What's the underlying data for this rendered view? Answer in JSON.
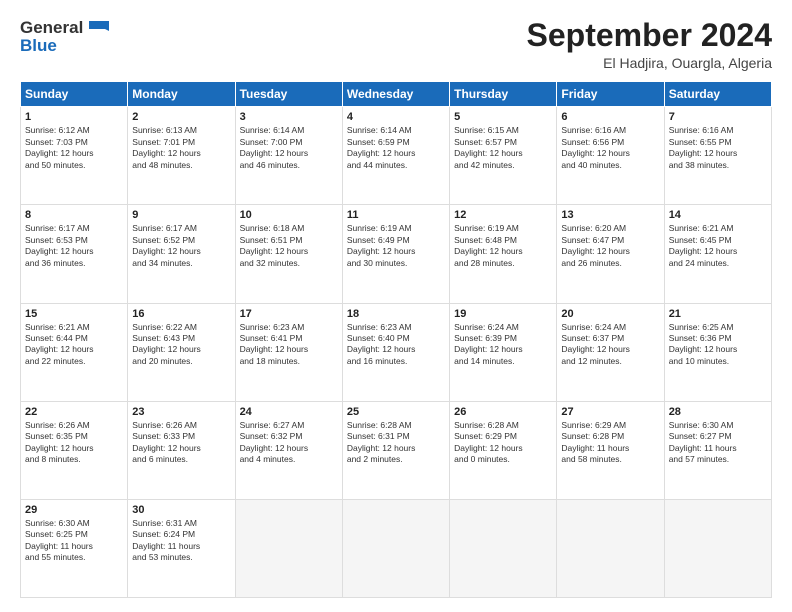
{
  "header": {
    "logo_general": "General",
    "logo_blue": "Blue",
    "month": "September 2024",
    "location": "El Hadjira, Ouargla, Algeria"
  },
  "days_of_week": [
    "Sunday",
    "Monday",
    "Tuesday",
    "Wednesday",
    "Thursday",
    "Friday",
    "Saturday"
  ],
  "weeks": [
    [
      {
        "day": "1",
        "lines": [
          "Sunrise: 6:12 AM",
          "Sunset: 7:03 PM",
          "Daylight: 12 hours",
          "and 50 minutes."
        ]
      },
      {
        "day": "2",
        "lines": [
          "Sunrise: 6:13 AM",
          "Sunset: 7:01 PM",
          "Daylight: 12 hours",
          "and 48 minutes."
        ]
      },
      {
        "day": "3",
        "lines": [
          "Sunrise: 6:14 AM",
          "Sunset: 7:00 PM",
          "Daylight: 12 hours",
          "and 46 minutes."
        ]
      },
      {
        "day": "4",
        "lines": [
          "Sunrise: 6:14 AM",
          "Sunset: 6:59 PM",
          "Daylight: 12 hours",
          "and 44 minutes."
        ]
      },
      {
        "day": "5",
        "lines": [
          "Sunrise: 6:15 AM",
          "Sunset: 6:57 PM",
          "Daylight: 12 hours",
          "and 42 minutes."
        ]
      },
      {
        "day": "6",
        "lines": [
          "Sunrise: 6:16 AM",
          "Sunset: 6:56 PM",
          "Daylight: 12 hours",
          "and 40 minutes."
        ]
      },
      {
        "day": "7",
        "lines": [
          "Sunrise: 6:16 AM",
          "Sunset: 6:55 PM",
          "Daylight: 12 hours",
          "and 38 minutes."
        ]
      }
    ],
    [
      {
        "day": "8",
        "lines": [
          "Sunrise: 6:17 AM",
          "Sunset: 6:53 PM",
          "Daylight: 12 hours",
          "and 36 minutes."
        ]
      },
      {
        "day": "9",
        "lines": [
          "Sunrise: 6:17 AM",
          "Sunset: 6:52 PM",
          "Daylight: 12 hours",
          "and 34 minutes."
        ]
      },
      {
        "day": "10",
        "lines": [
          "Sunrise: 6:18 AM",
          "Sunset: 6:51 PM",
          "Daylight: 12 hours",
          "and 32 minutes."
        ]
      },
      {
        "day": "11",
        "lines": [
          "Sunrise: 6:19 AM",
          "Sunset: 6:49 PM",
          "Daylight: 12 hours",
          "and 30 minutes."
        ]
      },
      {
        "day": "12",
        "lines": [
          "Sunrise: 6:19 AM",
          "Sunset: 6:48 PM",
          "Daylight: 12 hours",
          "and 28 minutes."
        ]
      },
      {
        "day": "13",
        "lines": [
          "Sunrise: 6:20 AM",
          "Sunset: 6:47 PM",
          "Daylight: 12 hours",
          "and 26 minutes."
        ]
      },
      {
        "day": "14",
        "lines": [
          "Sunrise: 6:21 AM",
          "Sunset: 6:45 PM",
          "Daylight: 12 hours",
          "and 24 minutes."
        ]
      }
    ],
    [
      {
        "day": "15",
        "lines": [
          "Sunrise: 6:21 AM",
          "Sunset: 6:44 PM",
          "Daylight: 12 hours",
          "and 22 minutes."
        ]
      },
      {
        "day": "16",
        "lines": [
          "Sunrise: 6:22 AM",
          "Sunset: 6:43 PM",
          "Daylight: 12 hours",
          "and 20 minutes."
        ]
      },
      {
        "day": "17",
        "lines": [
          "Sunrise: 6:23 AM",
          "Sunset: 6:41 PM",
          "Daylight: 12 hours",
          "and 18 minutes."
        ]
      },
      {
        "day": "18",
        "lines": [
          "Sunrise: 6:23 AM",
          "Sunset: 6:40 PM",
          "Daylight: 12 hours",
          "and 16 minutes."
        ]
      },
      {
        "day": "19",
        "lines": [
          "Sunrise: 6:24 AM",
          "Sunset: 6:39 PM",
          "Daylight: 12 hours",
          "and 14 minutes."
        ]
      },
      {
        "day": "20",
        "lines": [
          "Sunrise: 6:24 AM",
          "Sunset: 6:37 PM",
          "Daylight: 12 hours",
          "and 12 minutes."
        ]
      },
      {
        "day": "21",
        "lines": [
          "Sunrise: 6:25 AM",
          "Sunset: 6:36 PM",
          "Daylight: 12 hours",
          "and 10 minutes."
        ]
      }
    ],
    [
      {
        "day": "22",
        "lines": [
          "Sunrise: 6:26 AM",
          "Sunset: 6:35 PM",
          "Daylight: 12 hours",
          "and 8 minutes."
        ]
      },
      {
        "day": "23",
        "lines": [
          "Sunrise: 6:26 AM",
          "Sunset: 6:33 PM",
          "Daylight: 12 hours",
          "and 6 minutes."
        ]
      },
      {
        "day": "24",
        "lines": [
          "Sunrise: 6:27 AM",
          "Sunset: 6:32 PM",
          "Daylight: 12 hours",
          "and 4 minutes."
        ]
      },
      {
        "day": "25",
        "lines": [
          "Sunrise: 6:28 AM",
          "Sunset: 6:31 PM",
          "Daylight: 12 hours",
          "and 2 minutes."
        ]
      },
      {
        "day": "26",
        "lines": [
          "Sunrise: 6:28 AM",
          "Sunset: 6:29 PM",
          "Daylight: 12 hours",
          "and 0 minutes."
        ]
      },
      {
        "day": "27",
        "lines": [
          "Sunrise: 6:29 AM",
          "Sunset: 6:28 PM",
          "Daylight: 11 hours",
          "and 58 minutes."
        ]
      },
      {
        "day": "28",
        "lines": [
          "Sunrise: 6:30 AM",
          "Sunset: 6:27 PM",
          "Daylight: 11 hours",
          "and 57 minutes."
        ]
      }
    ],
    [
      {
        "day": "29",
        "lines": [
          "Sunrise: 6:30 AM",
          "Sunset: 6:25 PM",
          "Daylight: 11 hours",
          "and 55 minutes."
        ]
      },
      {
        "day": "30",
        "lines": [
          "Sunrise: 6:31 AM",
          "Sunset: 6:24 PM",
          "Daylight: 11 hours",
          "and 53 minutes."
        ]
      },
      {
        "day": "",
        "lines": []
      },
      {
        "day": "",
        "lines": []
      },
      {
        "day": "",
        "lines": []
      },
      {
        "day": "",
        "lines": []
      },
      {
        "day": "",
        "lines": []
      }
    ]
  ]
}
